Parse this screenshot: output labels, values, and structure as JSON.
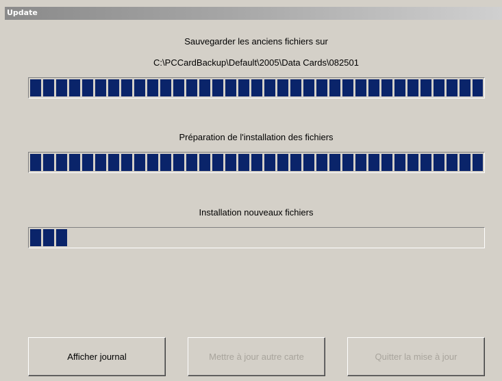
{
  "window": {
    "title": "Update"
  },
  "step1": {
    "label": "Sauvegarder les anciens fichiers sur",
    "path": "C:\\PCCardBackup\\Default\\2005\\Data Cards\\082501",
    "progress": 1.0
  },
  "step2": {
    "label": "Préparation de l'installation des fichiers",
    "progress": 1.0
  },
  "step3": {
    "label": "Installation nouveaux fichiers",
    "progress": 0.09
  },
  "buttons": {
    "show_log": "Afficher journal",
    "update_other_card": "Mettre à jour autre carte",
    "quit_update": "Quitter la mise à jour"
  },
  "colors": {
    "progress_fill": "#0a246a",
    "window_bg": "#d4d0c8",
    "disabled_text": "#a8a49c"
  }
}
